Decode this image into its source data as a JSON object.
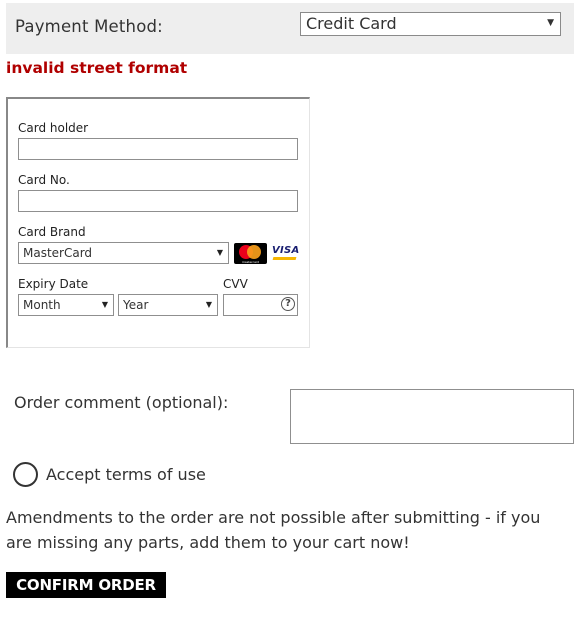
{
  "payment": {
    "label": "Payment Method:",
    "selected": "Credit Card"
  },
  "error": "invalid street format",
  "card": {
    "holder_label": "Card holder",
    "number_label": "Card No.",
    "brand_label": "Card Brand",
    "brand_selected": "MasterCard",
    "expiry_label": "Expiry Date",
    "month_selected": "Month",
    "year_selected": "Year",
    "cvv_label": "CVV",
    "help_glyph": "?",
    "logos": {
      "mastercard_text": "mastercard",
      "visa_text": "VISA"
    }
  },
  "comment": {
    "label": "Order comment (optional):",
    "value": ""
  },
  "terms": {
    "label": "Accept terms of use"
  },
  "notice": "Amendments to the order are not possible after submitting - if you are missing any parts, add them to your cart now!",
  "confirm_label": "CONFIRM ORDER",
  "colors": {
    "error": "#b00000",
    "button_bg": "#000000",
    "bar_bg": "#eeeeee"
  }
}
